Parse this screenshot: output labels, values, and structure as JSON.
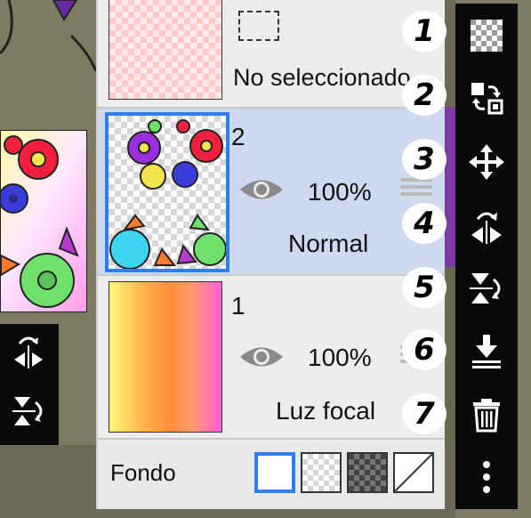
{
  "layers_panel": {
    "top_layer": {
      "name": "No seleccionado"
    },
    "layer_2": {
      "number": "2",
      "opacity": "100%",
      "blend_mode": "Normal"
    },
    "layer_1": {
      "number": "1",
      "opacity": "100%",
      "blend_mode": "Luz focal"
    },
    "background": {
      "label": "Fondo",
      "selected_swatch": "white"
    }
  },
  "annotations": [
    "1",
    "2",
    "3",
    "4",
    "5",
    "6",
    "7"
  ],
  "right_toolbar": {
    "icons": [
      "transparency-icon",
      "swap-layers-icon",
      "move-icon",
      "flip-horizontal-icon",
      "flip-vertical-icon",
      "merge-down-icon",
      "delete-icon",
      "more-icon"
    ]
  },
  "left_toolbar": {
    "icons": [
      "flip-horizontal-icon",
      "flip-vertical-icon"
    ]
  },
  "colors": {
    "selected_layer_bg": "#cdd9ee",
    "selection_blue": "#2f7ef0",
    "toolbar_bg": "#0a0a0a",
    "panel_bg": "#e8e8e8"
  }
}
